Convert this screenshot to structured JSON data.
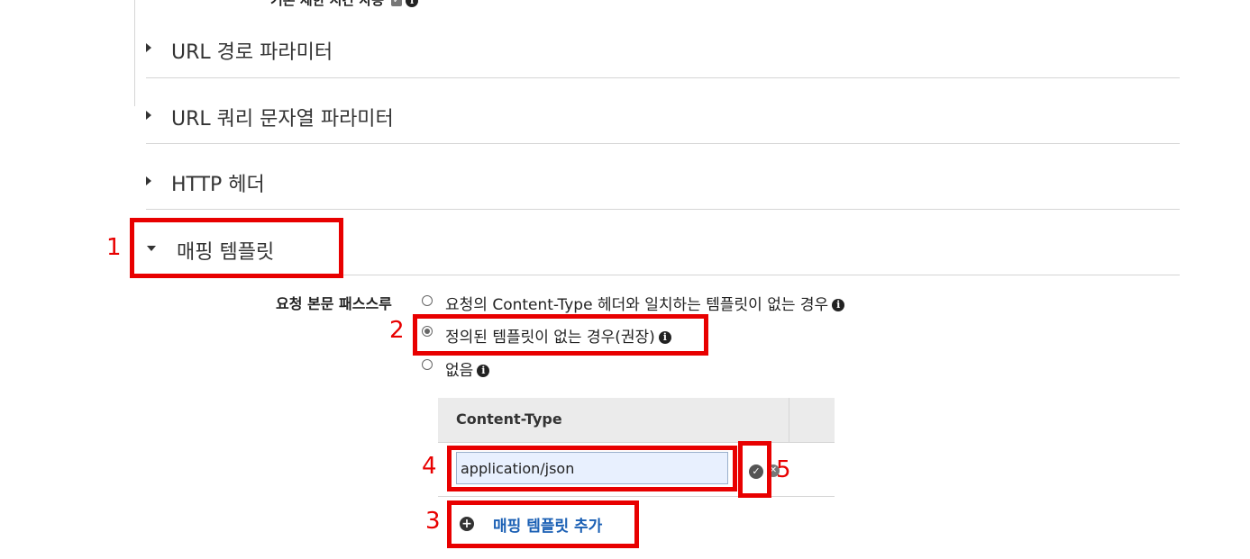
{
  "cut_off_setting": {
    "label": "기본 제한 시간 사용"
  },
  "sections": [
    {
      "label": "URL 경로 파라미터"
    },
    {
      "label": "URL 쿼리 문자열 파라미터"
    },
    {
      "label": "HTTP 헤더"
    },
    {
      "label": "매핑 템플릿"
    }
  ],
  "passthrough": {
    "label": "요청 본문 패스스루",
    "options": [
      {
        "label": "요청의 Content-Type 헤더와 일치하는 템플릿이 없는 경우",
        "selected": false
      },
      {
        "label": "정의된 템플릿이 없는 경우(권장)",
        "selected": true
      },
      {
        "label": "없음",
        "selected": false
      }
    ]
  },
  "content_type_table": {
    "header": "Content-Type",
    "input_value": "application/json"
  },
  "add_mapping_template_label": "매핑 템플릿 추가",
  "annotations": [
    "1",
    "2",
    "3",
    "4",
    "5"
  ],
  "colors": {
    "annotation_red": "#e80000",
    "link_blue": "#1a5fb4",
    "input_bg": "#e8f0fe"
  }
}
